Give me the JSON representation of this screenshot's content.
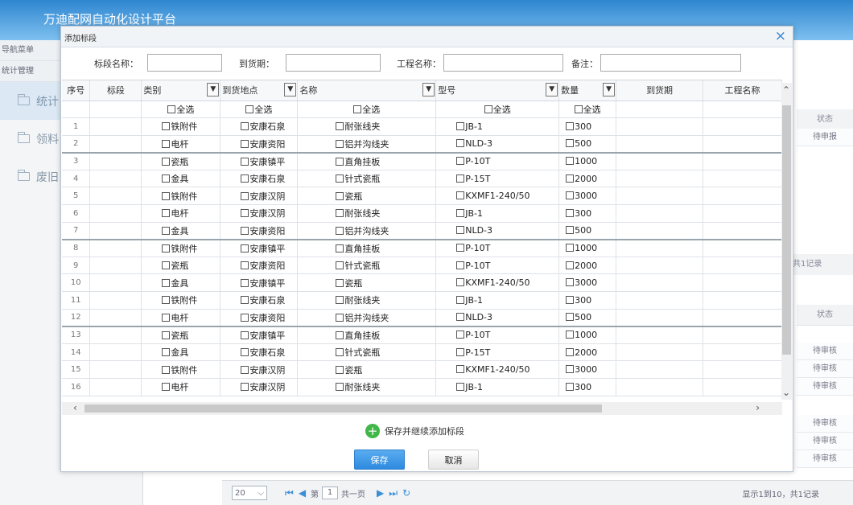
{
  "app": {
    "title": "万迪配网自动化设计平台"
  },
  "nav": {
    "head1": "导航菜单",
    "head2": "统计管理",
    "items": [
      "统计",
      "领料",
      "废旧"
    ]
  },
  "background_table": {
    "status_header": "状态",
    "status_header2": "状态",
    "rows_top": [
      "待申报"
    ],
    "record_text": "共1记录",
    "rows_bottom": [
      "待审核",
      "待审核",
      "待审核",
      "待审核",
      "待审核",
      "待审核"
    ]
  },
  "pager": {
    "page_size": "20",
    "page_label": "第",
    "page_value": "1",
    "page_total": "共一页",
    "summary": "显示1到10，共1记录"
  },
  "dialog": {
    "title": "添加标段",
    "close_icon": "×",
    "filters": {
      "section_name_label": "标段名称：",
      "arrival_label": "到货期：",
      "project_name_label": "工程名称：",
      "remark_label": "备注："
    },
    "grid": {
      "columns": {
        "seq": "序号",
        "section": "标段",
        "category": "类别",
        "location": "到货地点",
        "name": "名称",
        "model": "型号",
        "quantity": "数量",
        "arrival": "到货期",
        "project": "工程名称"
      },
      "select_all": "全选",
      "rows": [
        [
          "1",
          "铁附件",
          "安康石泉",
          "耐张线夹",
          "JB-1",
          "300"
        ],
        [
          "2",
          "电杆",
          "安康资阳",
          "铝并沟线夹",
          "NLD-3",
          "500"
        ],
        [
          "3",
          "瓷瓶",
          "安康镇平",
          "直角挂板",
          "P-10T",
          "1000"
        ],
        [
          "4",
          "金具",
          "安康石泉",
          "针式瓷瓶",
          "P-15T",
          "2000"
        ],
        [
          "5",
          "铁附件",
          "安康汉阴",
          "瓷瓶",
          "KXMF1-240/50",
          "3000"
        ],
        [
          "6",
          "电杆",
          "安康汉阴",
          "耐张线夹",
          "JB-1",
          "300"
        ],
        [
          "7",
          "金具",
          "安康资阳",
          "铝并沟线夹",
          "NLD-3",
          "500"
        ],
        [
          "8",
          "铁附件",
          "安康镇平",
          "直角挂板",
          "P-10T",
          "1000"
        ],
        [
          "9",
          "瓷瓶",
          "安康资阳",
          "针式瓷瓶",
          "P-10T",
          "2000"
        ],
        [
          "10",
          "金具",
          "安康镇平",
          "瓷瓶",
          "KXMF1-240/50",
          "3000"
        ],
        [
          "11",
          "铁附件",
          "安康石泉",
          "耐张线夹",
          "JB-1",
          "300"
        ],
        [
          "12",
          "电杆",
          "安康资阳",
          "铝并沟线夹",
          "NLD-3",
          "500"
        ],
        [
          "13",
          "瓷瓶",
          "安康镇平",
          "直角挂板",
          "P-10T",
          "1000"
        ],
        [
          "14",
          "金具",
          "安康石泉",
          "针式瓷瓶",
          "P-15T",
          "2000"
        ],
        [
          "15",
          "铁附件",
          "安康汉阴",
          "瓷瓶",
          "KXMF1-240/50",
          "3000"
        ],
        [
          "16",
          "电杆",
          "安康汉阴",
          "耐张线夹",
          "JB-1",
          "300"
        ]
      ]
    },
    "add_more_label": "保存并继续添加标段",
    "save_label": "保存",
    "cancel_label": "取消"
  }
}
